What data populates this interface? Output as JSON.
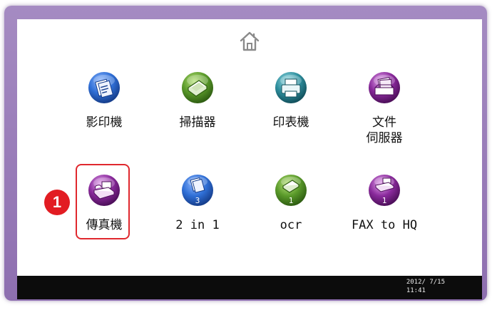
{
  "apps": [
    {
      "label": "影印機"
    },
    {
      "label": "掃描器"
    },
    {
      "label": "印表機"
    },
    {
      "label": "文件\n伺服器"
    },
    {
      "label": "傳真機"
    },
    {
      "label": "2 in 1",
      "badge": "3"
    },
    {
      "label": "ocr",
      "badge": "1"
    },
    {
      "label": "FAX to HQ",
      "badge": "1"
    }
  ],
  "annotation": {
    "marker": "1"
  },
  "status": {
    "date": "2012/ 7/15",
    "time": "11:41"
  },
  "icons": {
    "home": "home-icon",
    "copier": "copier-icon",
    "scanner": "scanner-icon",
    "printer": "printer-icon",
    "document_server": "document-server-icon",
    "fax": "fax-icon"
  },
  "colors": {
    "frame": "#9a7dbb",
    "blue": "#2f6fd6",
    "green": "#5a9a2a",
    "teal": "#2e8f9e",
    "purple": "#8a2a9c",
    "highlight": "#e0282e",
    "statusbar": "#0c0c0c"
  }
}
